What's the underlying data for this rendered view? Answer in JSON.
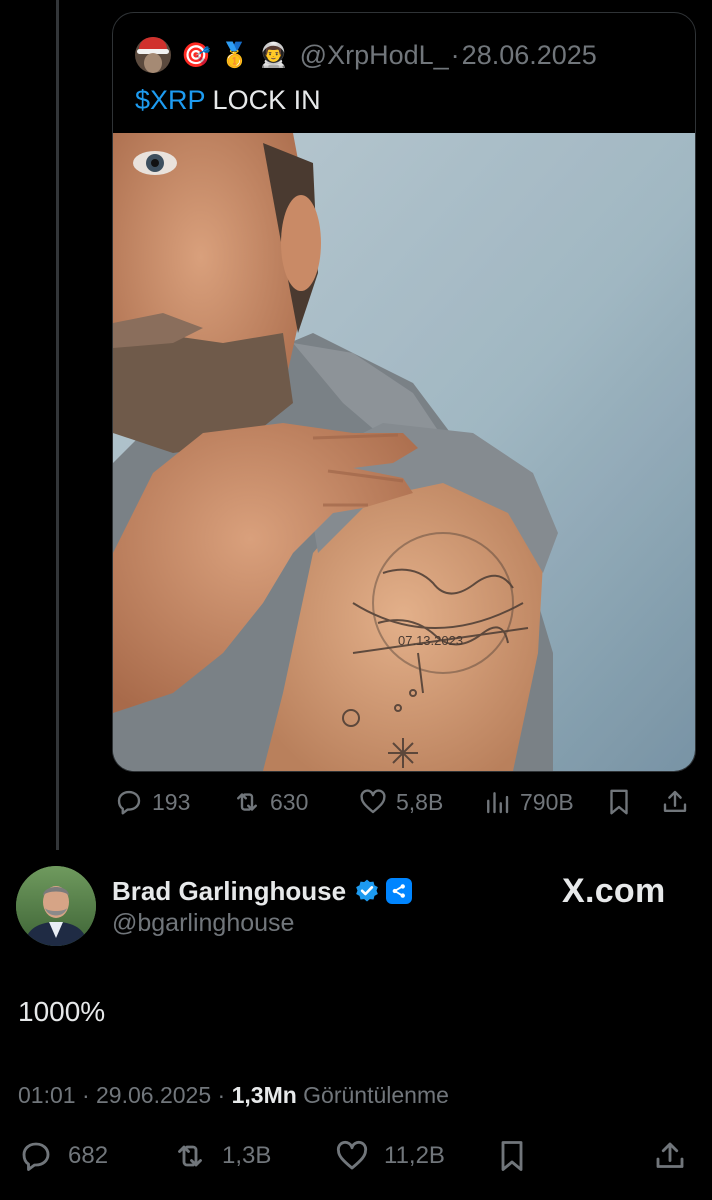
{
  "quoted": {
    "emojis": [
      "🎯",
      "🥇",
      "👨‍🚀"
    ],
    "handle": "@XrpHodL_",
    "separator": "·",
    "date": "28.06.2025",
    "cashtag": "$XRP",
    "text": " LOCK IN",
    "photo_description": "Selfie of a bearded man lifting his t-shirt sleeve to show an XRP logo tattoo dated 07.13.2023 on his upper arm",
    "tattoo_date": "07.13.2023",
    "stats": {
      "replies": "193",
      "reposts": "630",
      "likes": "5,8B",
      "views": "790B"
    }
  },
  "author": {
    "name": "Brad Garlinghouse",
    "handle": "@bgarlinghouse",
    "verified_color": "#1d9bf0",
    "affiliate_color": "#0085ff"
  },
  "watermark": "X.com",
  "tweet": {
    "text": "1000%",
    "time": "01:01",
    "separator": "·",
    "date": "29.06.2025",
    "views_count": "1,3Mn",
    "views_label": "Görüntülenme",
    "stats": {
      "replies": "682",
      "reposts": "1,3B",
      "likes": "11,2B"
    }
  },
  "colors": {
    "background": "#000000",
    "text": "#e7e9ea",
    "muted": "#71767b",
    "accent": "#1d9bf0",
    "border": "#2f3336"
  },
  "icons": [
    "reply-icon",
    "repost-icon",
    "like-icon",
    "views-icon",
    "bookmark-icon",
    "share-icon",
    "verified-badge-icon",
    "ripple-affiliate-icon"
  ]
}
